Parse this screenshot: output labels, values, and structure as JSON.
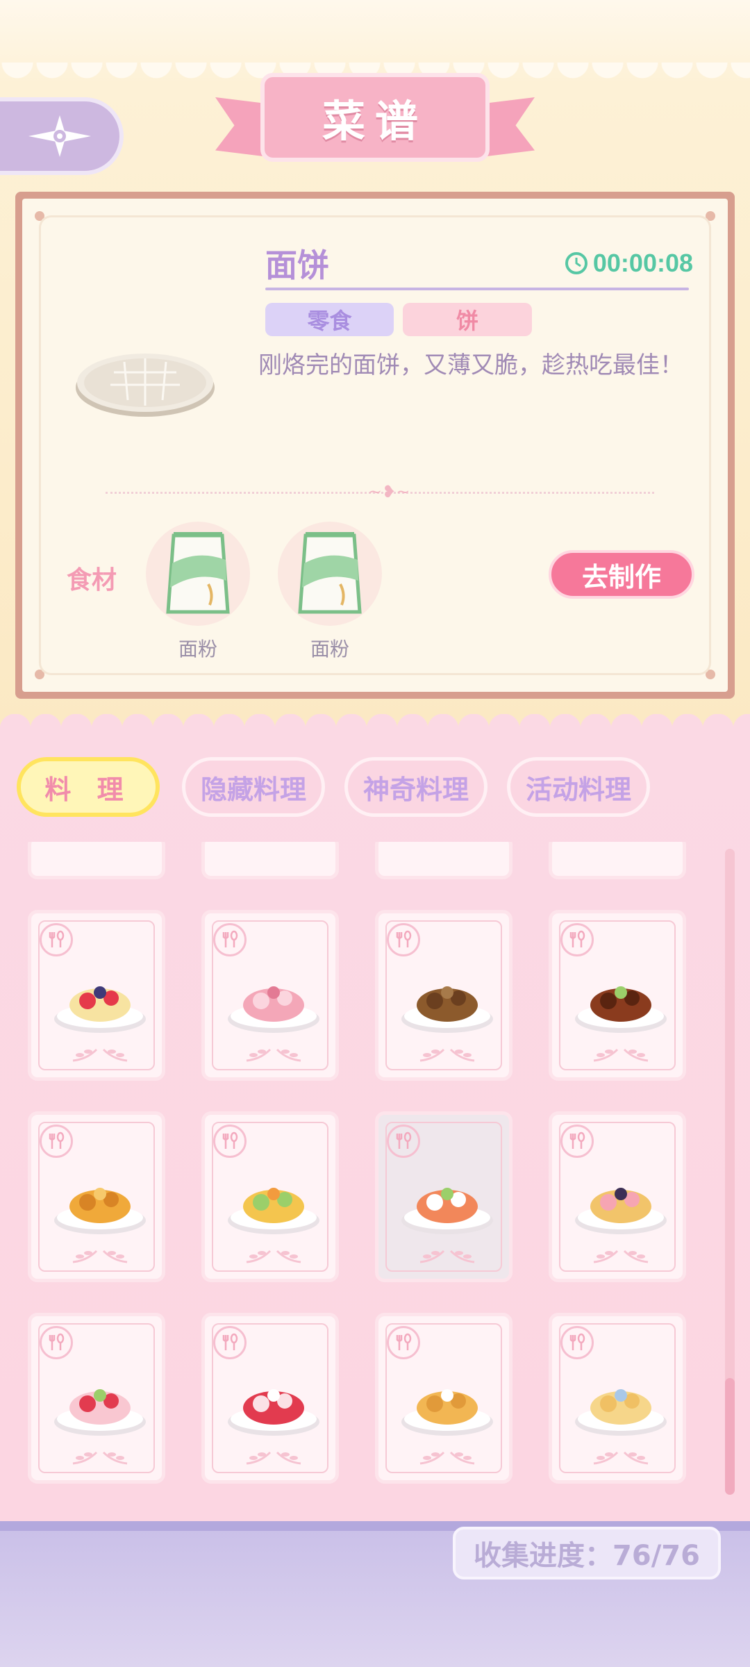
{
  "header": {
    "title": "菜谱",
    "back_icon": "compass-star-icon"
  },
  "detail": {
    "name": "面饼",
    "timer": "00:00:08",
    "tags": [
      "零食",
      "饼"
    ],
    "description": "刚烙完的面饼，又薄又脆，趁热吃最佳！",
    "ingredients_label": "食材",
    "ingredients": [
      {
        "name": "面粉",
        "icon": "flour-bag-icon"
      },
      {
        "name": "面粉",
        "icon": "flour-bag-icon"
      }
    ],
    "make_button": "去制作"
  },
  "tabs": [
    {
      "label": "料 理",
      "active": true
    },
    {
      "label": "隐藏料理",
      "active": false
    },
    {
      "label": "神奇料理",
      "active": false
    },
    {
      "label": "活动料理",
      "active": false
    }
  ],
  "recipes": [
    "fruit-taco-icon",
    "strawberry-jelly-icon",
    "meatball-icon",
    "braised-pork-icon",
    "orange-chicken-icon",
    "omelette-platter-icon",
    "salmon-plate-icon",
    "swiss-roll-bites-icon",
    "strawberry-roll-cake-icon",
    "strawberry-pudding-icon",
    "pancake-stack-icon",
    "toast-sandwich-icon"
  ],
  "footer": {
    "progress": "收集进度：76/76"
  },
  "colors": {
    "accent_pink": "#f6789a",
    "accent_purple": "#b590d8",
    "timer_green": "#56c7a4"
  }
}
